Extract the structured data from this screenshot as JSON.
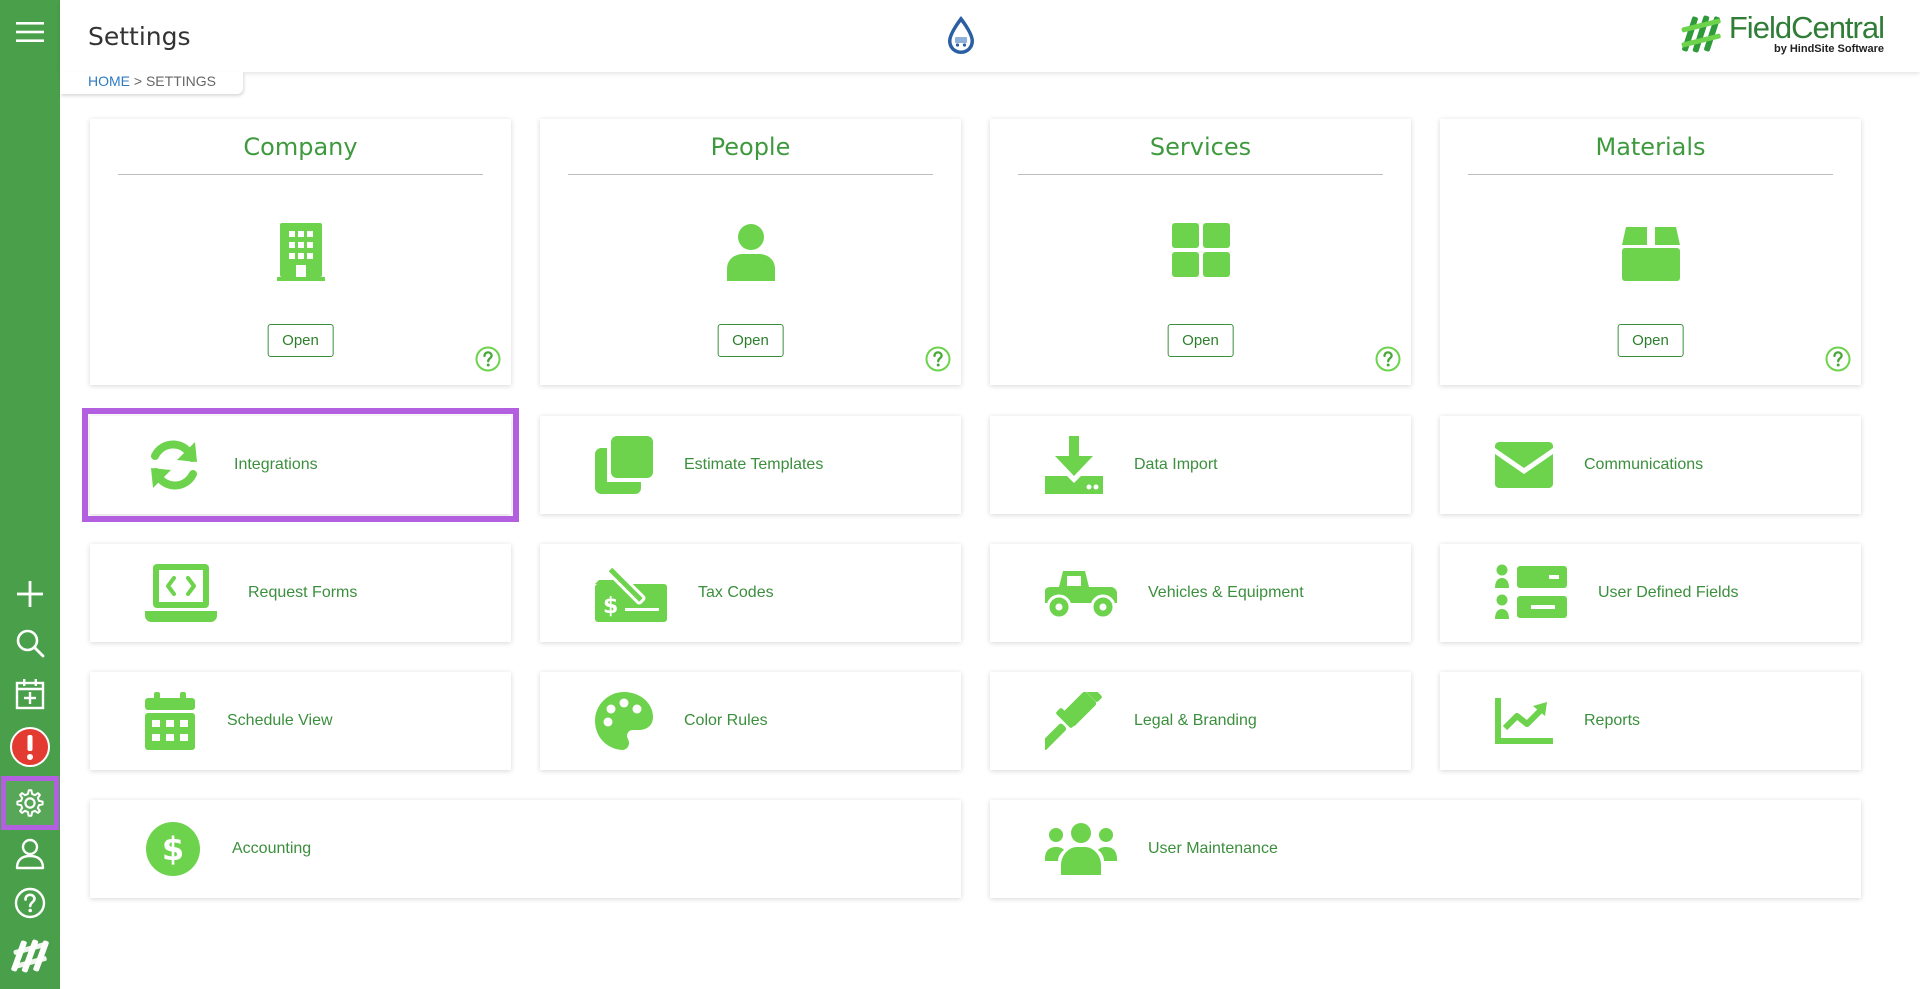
{
  "header": {
    "title": "Settings",
    "brand_name": "FieldCentral",
    "brand_sub": "by HindSite Software"
  },
  "breadcrumb": {
    "home": "HOME",
    "separator": " > ",
    "current": "SETTINGS"
  },
  "main_sections": [
    {
      "title": "Company",
      "icon": "building-icon",
      "button": "Open"
    },
    {
      "title": "People",
      "icon": "person-icon",
      "button": "Open"
    },
    {
      "title": "Services",
      "icon": "grid-icon",
      "button": "Open"
    },
    {
      "title": "Materials",
      "icon": "box-icon",
      "button": "Open"
    }
  ],
  "tiles": [
    {
      "label": "Integrations",
      "icon": "sync-icon",
      "highlighted": true
    },
    {
      "label": "Estimate Templates",
      "icon": "copy-icon"
    },
    {
      "label": "Data Import",
      "icon": "download-icon"
    },
    {
      "label": "Communications",
      "icon": "envelope-icon"
    },
    {
      "label": "Request Forms",
      "icon": "laptop-code-icon"
    },
    {
      "label": "Tax Codes",
      "icon": "money-check-icon"
    },
    {
      "label": "Vehicles & Equipment",
      "icon": "truck-icon"
    },
    {
      "label": "User Defined Fields",
      "icon": "list-icon"
    },
    {
      "label": "Schedule View",
      "icon": "calendar-icon"
    },
    {
      "label": "Color Rules",
      "icon": "palette-icon"
    },
    {
      "label": "Legal & Branding",
      "icon": "gavel-icon"
    },
    {
      "label": "Reports",
      "icon": "chart-line-icon"
    },
    {
      "label": "Accounting",
      "icon": "dollar-circle-icon"
    },
    {
      "label": "User Maintenance",
      "icon": "users-icon"
    }
  ],
  "sidebar": {
    "items": [
      {
        "icon": "menu-icon"
      },
      {
        "icon": "plus-icon"
      },
      {
        "icon": "search-icon"
      },
      {
        "icon": "calendar-add-icon"
      },
      {
        "icon": "alert-icon"
      },
      {
        "icon": "gear-icon",
        "active": true
      },
      {
        "icon": "user-icon"
      },
      {
        "icon": "help-icon"
      },
      {
        "icon": "fieldcentral-logo-icon"
      }
    ]
  },
  "colors": {
    "sidebar": "#4a9f4a",
    "icon_green": "#6dd34c",
    "title_green": "#3f9a3f",
    "highlight": "#b25fe0",
    "alert_red": "#e33b31"
  }
}
